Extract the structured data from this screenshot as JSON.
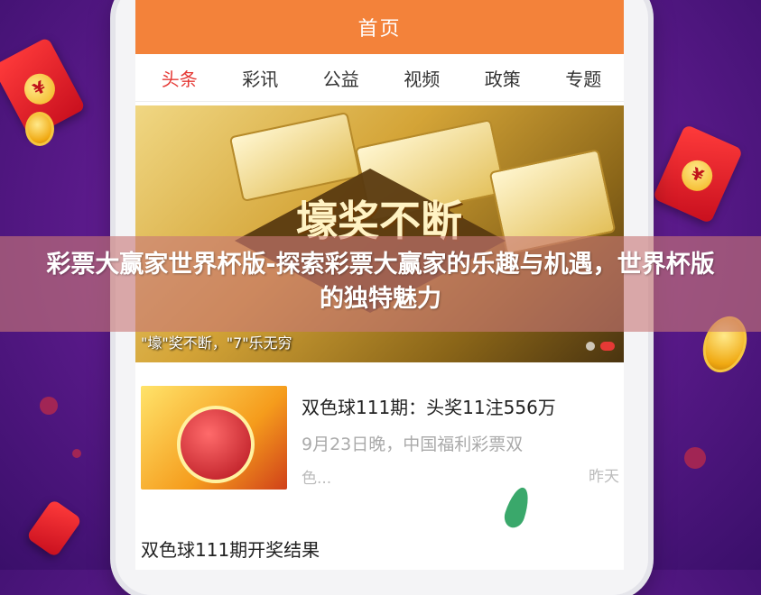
{
  "app": {
    "header_title": "首页",
    "tabs": [
      "头条",
      "彩讯",
      "公益",
      "视频",
      "政策",
      "专题"
    ],
    "active_tab_index": 0
  },
  "banner": {
    "headline": "壕奖不断",
    "caption": "\"壕\"奖不断，\"7\"乐无穷"
  },
  "news": [
    {
      "title": "双色球111期：头奖11注556万",
      "summary": "9月23日晚，中国福利彩票双",
      "summary_line2": "色...",
      "time": "昨天"
    },
    {
      "title": "双色球111期开奖结果"
    }
  ],
  "overlay_title": "彩票大赢家世界杯版-探索彩票大赢家的乐趣与机遇，世界杯版的独特魅力",
  "decor": {
    "envelope_symbol": "¥",
    "colors": {
      "background": "#6a2a9a",
      "header": "#f3823a",
      "active_tab": "#e53935",
      "overlay": "#c87878"
    }
  }
}
